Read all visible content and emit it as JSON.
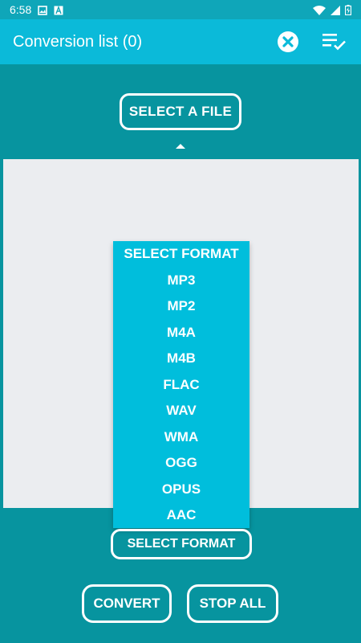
{
  "status_bar": {
    "time": "6:58",
    "icons": [
      "image-icon",
      "a-icon",
      "wifi-icon",
      "signal-icon",
      "battery-icon"
    ]
  },
  "app_bar": {
    "title": "Conversion list (0)",
    "actions": [
      "clear-icon",
      "checklist-icon"
    ]
  },
  "buttons": {
    "select_file": "SELECT A FILE",
    "select_format": "SELECT FORMAT",
    "convert": "CONVERT",
    "stop_all": "STOP ALL"
  },
  "format_dropdown": {
    "items": [
      "SELECT FORMAT",
      "MP3",
      "MP2",
      "M4A",
      "M4B",
      "FLAC",
      "WAV",
      "WMA",
      "OGG",
      "OPUS",
      "AAC"
    ]
  },
  "colors": {
    "background": "#07949f",
    "app_bar": "#0bbad9",
    "status_bar": "#0fa6b9",
    "panel": "#ebedf0",
    "dropdown": "#00bedc"
  }
}
